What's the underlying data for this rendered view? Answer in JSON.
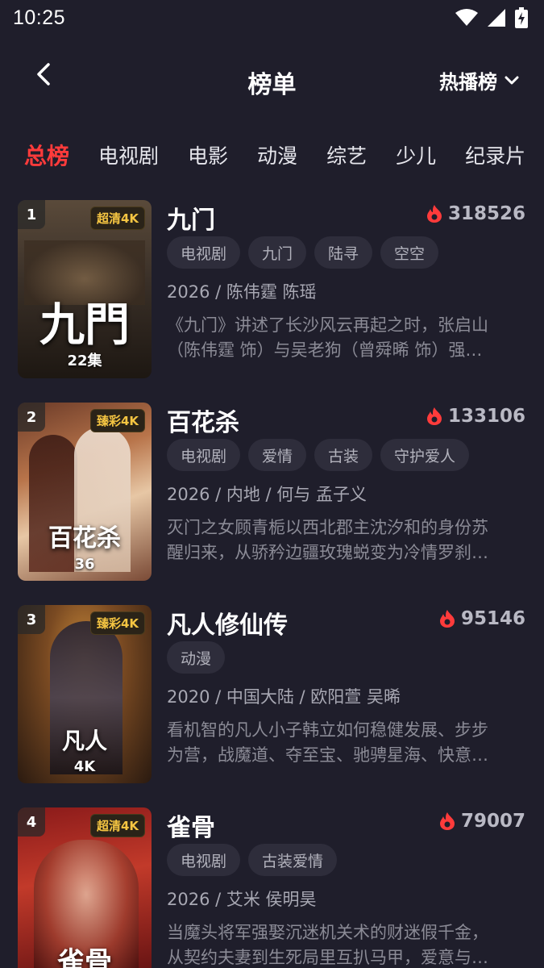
{
  "status": {
    "time": "10:25"
  },
  "header": {
    "title": "榜单",
    "rank_type": "热播榜"
  },
  "tabs": [
    "总榜",
    "电视剧",
    "电影",
    "动漫",
    "综艺",
    "少儿",
    "纪录片"
  ],
  "colors": {
    "background": "#1f1e2b",
    "accent": "#ff3b3b",
    "tag_bg": "#2e2d3b",
    "quality_badge": "#f5c542"
  },
  "items": [
    {
      "rank": "1",
      "quality": "超清4K",
      "episodes": "22集",
      "poster_title": "九門",
      "title": "九门",
      "heat": "318526",
      "tags": [
        "电视剧",
        "九门",
        "陆寻",
        "空空"
      ],
      "meta": "2026 / 陈伟霆 陈瑶",
      "desc1": "《九门》讲述了长沙风云再起之时，张启山",
      "desc2": "（陈伟霆 饰）与吴老狗（曾舜晞 饰）强…"
    },
    {
      "rank": "2",
      "quality": "臻彩4K",
      "episodes": "36",
      "poster_title": "百花杀",
      "title": "百花杀",
      "heat": "133106",
      "tags": [
        "电视剧",
        "爱情",
        "古装",
        "守护爱人"
      ],
      "meta": "2026 / 内地 / 何与 孟子义",
      "desc1": "灭门之女顾青栀以西北郡主沈汐和的身份苏",
      "desc2": "醒归来，从骄矜边疆玫瑰蜕变为冷情罗刹…"
    },
    {
      "rank": "3",
      "quality": "臻彩4K",
      "episodes": "4K",
      "poster_title": "凡人",
      "title": "凡人修仙传",
      "heat": "95146",
      "tags": [
        "动漫"
      ],
      "meta": "2020 / 中国大陆 / 欧阳萱 吴晞",
      "desc1": "看机智的凡人小子韩立如何稳健发展、步步",
      "desc2": "为营，战魔道、夺至宝、驰骋星海、快意…"
    },
    {
      "rank": "4",
      "quality": "超清4K",
      "episodes": "",
      "poster_title": "雀骨",
      "title": "雀骨",
      "heat": "79007",
      "tags": [
        "电视剧",
        "古装爱情"
      ],
      "meta": "2026 / 艾米 侯明昊",
      "desc1": "当魔头将军强娶沉迷机关术的财迷假千金，",
      "desc2": "从契约夫妻到生死局里互扒马甲，爱意与…"
    }
  ]
}
